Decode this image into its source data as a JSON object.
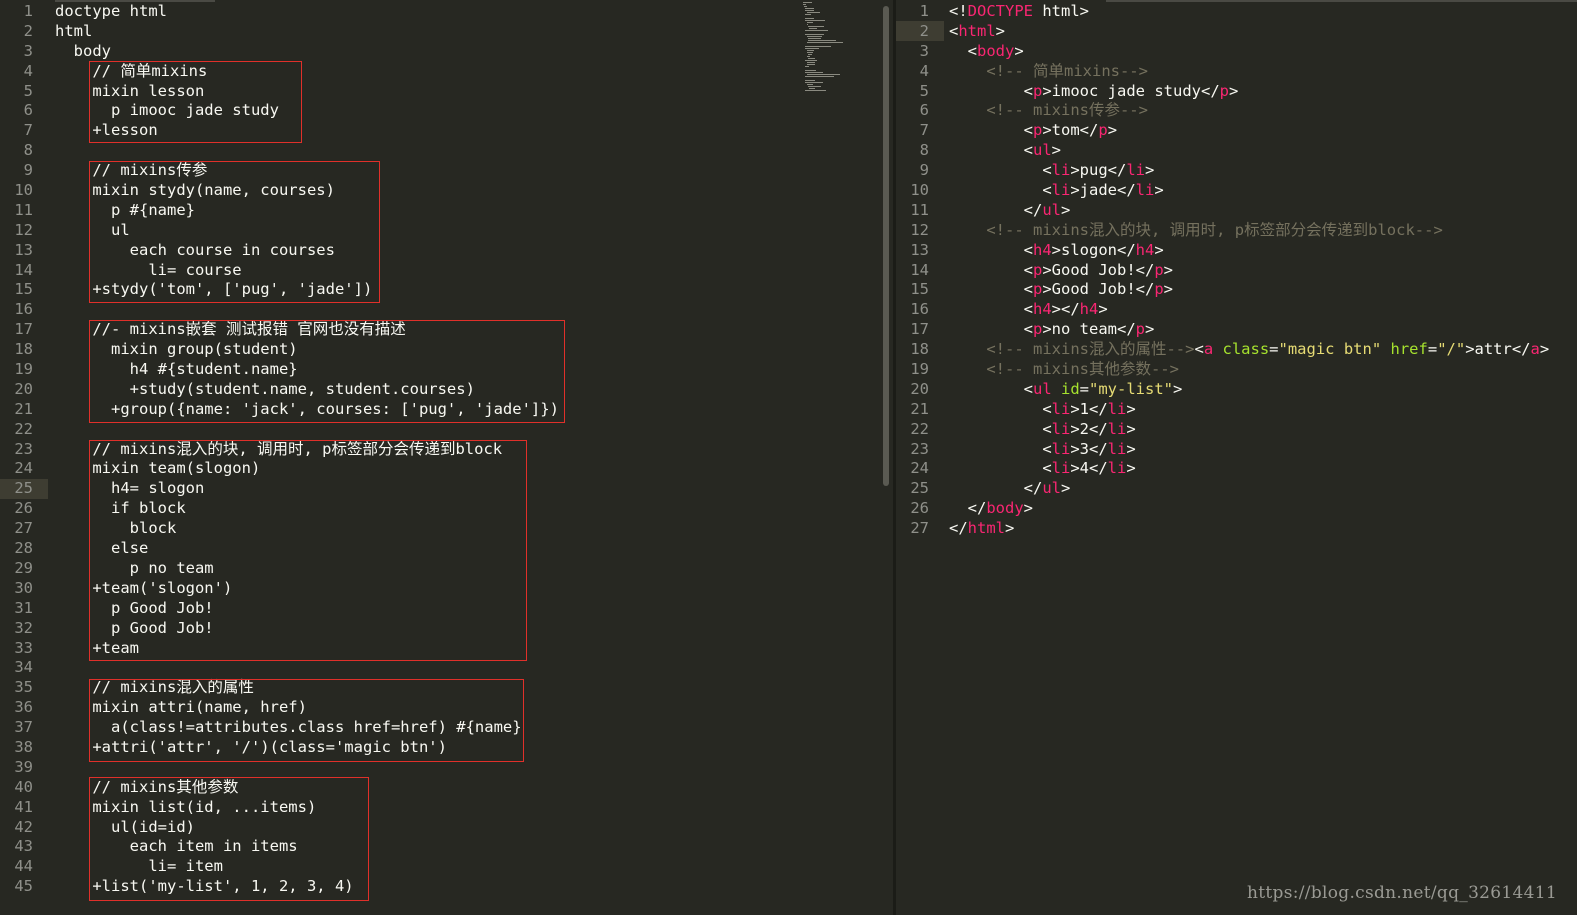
{
  "left_editor": {
    "active_line": 25,
    "lines": [
      "doctype html",
      "html",
      "  body",
      "    // 简单mixins",
      "    mixin lesson",
      "      p imooc jade study",
      "    +lesson",
      "",
      "    // mixins传参",
      "    mixin stydy(name, courses)",
      "      p #{name}",
      "      ul",
      "        each course in courses",
      "          li= course",
      "    +stydy('tom', ['pug', 'jade'])",
      "",
      "    //- mixins嵌套 测试报错 官网也没有描述",
      "      mixin group(student)",
      "        h4 #{student.name}",
      "        +study(student.name, student.courses)",
      "      +group({name: 'jack', courses: ['pug', 'jade']})",
      "",
      "    // mixins混入的块, 调用时, p标签部分会传递到block",
      "    mixin team(slogon)",
      "      h4= slogon",
      "      if block",
      "        block",
      "      else",
      "        p no team",
      "    +team('slogon')",
      "      p Good Job!",
      "      p Good Job!",
      "    +team",
      "",
      "    // mixins混入的属性",
      "    mixin attri(name, href)",
      "      a(class!=attributes.class href=href) #{name}",
      "    +attri('attr', '/')(class='magic btn')",
      "",
      "    // mixins其他参数",
      "    mixin list(id, ...items)",
      "      ul(id=id)",
      "        each item in items",
      "          li= item",
      "    +list('my-list', 1, 2, 3, 4)"
    ]
  },
  "right_editor": {
    "active_line": 2,
    "lines": [
      [
        [
          "txt",
          "<!"
        ],
        [
          "tag",
          "DOCTYPE"
        ],
        [
          "txt",
          " html>"
        ]
      ],
      [
        [
          "txt",
          "<"
        ],
        [
          "tag",
          "html"
        ],
        [
          "txt",
          ">"
        ]
      ],
      [
        [
          "txt",
          "  <"
        ],
        [
          "tag",
          "body"
        ],
        [
          "txt",
          ">"
        ]
      ],
      [
        [
          "cmt",
          "    <!-- 简单mixins-->"
        ]
      ],
      [
        [
          "txt",
          "        <"
        ],
        [
          "tag",
          "p"
        ],
        [
          "txt",
          ">imooc jade study</"
        ],
        [
          "tag",
          "p"
        ],
        [
          "txt",
          ">"
        ]
      ],
      [
        [
          "cmt",
          "    <!-- mixins传参-->"
        ]
      ],
      [
        [
          "txt",
          "        <"
        ],
        [
          "tag",
          "p"
        ],
        [
          "txt",
          ">tom</"
        ],
        [
          "tag",
          "p"
        ],
        [
          "txt",
          ">"
        ]
      ],
      [
        [
          "txt",
          "        <"
        ],
        [
          "tag",
          "ul"
        ],
        [
          "txt",
          ">"
        ]
      ],
      [
        [
          "txt",
          "          <"
        ],
        [
          "tag",
          "li"
        ],
        [
          "txt",
          ">pug</"
        ],
        [
          "tag",
          "li"
        ],
        [
          "txt",
          ">"
        ]
      ],
      [
        [
          "txt",
          "          <"
        ],
        [
          "tag",
          "li"
        ],
        [
          "txt",
          ">jade</"
        ],
        [
          "tag",
          "li"
        ],
        [
          "txt",
          ">"
        ]
      ],
      [
        [
          "txt",
          "        </"
        ],
        [
          "tag",
          "ul"
        ],
        [
          "txt",
          ">"
        ]
      ],
      [
        [
          "cmt",
          "    <!-- mixins混入的块, 调用时, p标签部分会传递到block-->"
        ]
      ],
      [
        [
          "txt",
          "        <"
        ],
        [
          "tag",
          "h4"
        ],
        [
          "txt",
          ">slogon</"
        ],
        [
          "tag",
          "h4"
        ],
        [
          "txt",
          ">"
        ]
      ],
      [
        [
          "txt",
          "        <"
        ],
        [
          "tag",
          "p"
        ],
        [
          "txt",
          ">Good Job!</"
        ],
        [
          "tag",
          "p"
        ],
        [
          "txt",
          ">"
        ]
      ],
      [
        [
          "txt",
          "        <"
        ],
        [
          "tag",
          "p"
        ],
        [
          "txt",
          ">Good Job!</"
        ],
        [
          "tag",
          "p"
        ],
        [
          "txt",
          ">"
        ]
      ],
      [
        [
          "txt",
          "        <"
        ],
        [
          "tag",
          "h4"
        ],
        [
          "txt",
          "></"
        ],
        [
          "tag",
          "h4"
        ],
        [
          "txt",
          ">"
        ]
      ],
      [
        [
          "txt",
          "        <"
        ],
        [
          "tag",
          "p"
        ],
        [
          "txt",
          ">no team</"
        ],
        [
          "tag",
          "p"
        ],
        [
          "txt",
          ">"
        ]
      ],
      [
        [
          "cmt",
          "    <!-- mixins混入的属性-->"
        ],
        [
          "txt",
          "<"
        ],
        [
          "tag",
          "a"
        ],
        [
          "attr",
          " class"
        ],
        [
          "txt",
          "="
        ],
        [
          "str",
          "\"magic btn\""
        ],
        [
          "attr",
          " href"
        ],
        [
          "txt",
          "="
        ],
        [
          "str",
          "\"/\""
        ],
        [
          "txt",
          ">attr</"
        ],
        [
          "tag",
          "a"
        ],
        [
          "txt",
          ">"
        ]
      ],
      [
        [
          "cmt",
          "    <!-- mixins其他参数-->"
        ]
      ],
      [
        [
          "txt",
          "        <"
        ],
        [
          "tag",
          "ul"
        ],
        [
          "attr",
          " id"
        ],
        [
          "txt",
          "="
        ],
        [
          "str",
          "\"my-list\""
        ],
        [
          "txt",
          ">"
        ]
      ],
      [
        [
          "txt",
          "          <"
        ],
        [
          "tag",
          "li"
        ],
        [
          "txt",
          ">1</"
        ],
        [
          "tag",
          "li"
        ],
        [
          "txt",
          ">"
        ]
      ],
      [
        [
          "txt",
          "          <"
        ],
        [
          "tag",
          "li"
        ],
        [
          "txt",
          ">2</"
        ],
        [
          "tag",
          "li"
        ],
        [
          "txt",
          ">"
        ]
      ],
      [
        [
          "txt",
          "          <"
        ],
        [
          "tag",
          "li"
        ],
        [
          "txt",
          ">3</"
        ],
        [
          "tag",
          "li"
        ],
        [
          "txt",
          ">"
        ]
      ],
      [
        [
          "txt",
          "          <"
        ],
        [
          "tag",
          "li"
        ],
        [
          "txt",
          ">4</"
        ],
        [
          "tag",
          "li"
        ],
        [
          "txt",
          ">"
        ]
      ],
      [
        [
          "txt",
          "        </"
        ],
        [
          "tag",
          "ul"
        ],
        [
          "txt",
          ">"
        ]
      ],
      [
        [
          "txt",
          "  </"
        ],
        [
          "tag",
          "body"
        ],
        [
          "txt",
          ">"
        ]
      ],
      [
        [
          "txt",
          "</"
        ],
        [
          "tag",
          "html"
        ],
        [
          "txt",
          ">"
        ]
      ]
    ]
  },
  "watermark": "https://blog.csdn.net/qq_32614411",
  "colors": {
    "background": "#272822",
    "tag": "#f92672",
    "attribute": "#a6e22e",
    "string": "#e6db74",
    "comment": "#75715e",
    "highlight_box": "#e0302a"
  }
}
